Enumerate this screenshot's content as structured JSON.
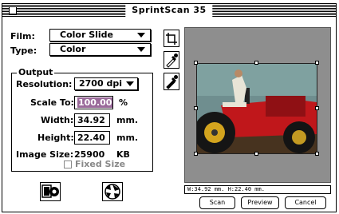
{
  "window": {
    "title": "SprintScan 35"
  },
  "film": {
    "label": "Film:",
    "value": "Color Slide"
  },
  "type": {
    "label": "Type:",
    "value": "Color"
  },
  "output": {
    "group_label": "Output",
    "resolution": {
      "label": "Resolution:",
      "value": "2700 dpi"
    },
    "scale": {
      "label": "Scale To:",
      "value": "100.00",
      "unit": "%"
    },
    "width": {
      "label": "Width:",
      "value": "34.92",
      "unit": "mm."
    },
    "height": {
      "label": "Height:",
      "value": "22.40",
      "unit": "mm."
    },
    "image_size": {
      "label": "Image Size:",
      "value": "25900",
      "unit": "KB"
    },
    "fixed_size": {
      "label": "Fixed Size",
      "checked": false
    }
  },
  "tools": [
    "crop-icon",
    "eyedropper-white-icon",
    "eyedropper-black-icon"
  ],
  "bottom_icons": [
    "scanner-settings-icon",
    "aperture-icon"
  ],
  "preview": {
    "status": "W:34.92 mm.  H:22.40 mm."
  },
  "buttons": {
    "scan": "Scan",
    "preview": "Preview",
    "cancel": "Cancel"
  },
  "colors": {
    "preview_bg": "#8e8e8e",
    "selection": "#9a6a9a",
    "tractor_red": "#c0171b"
  }
}
